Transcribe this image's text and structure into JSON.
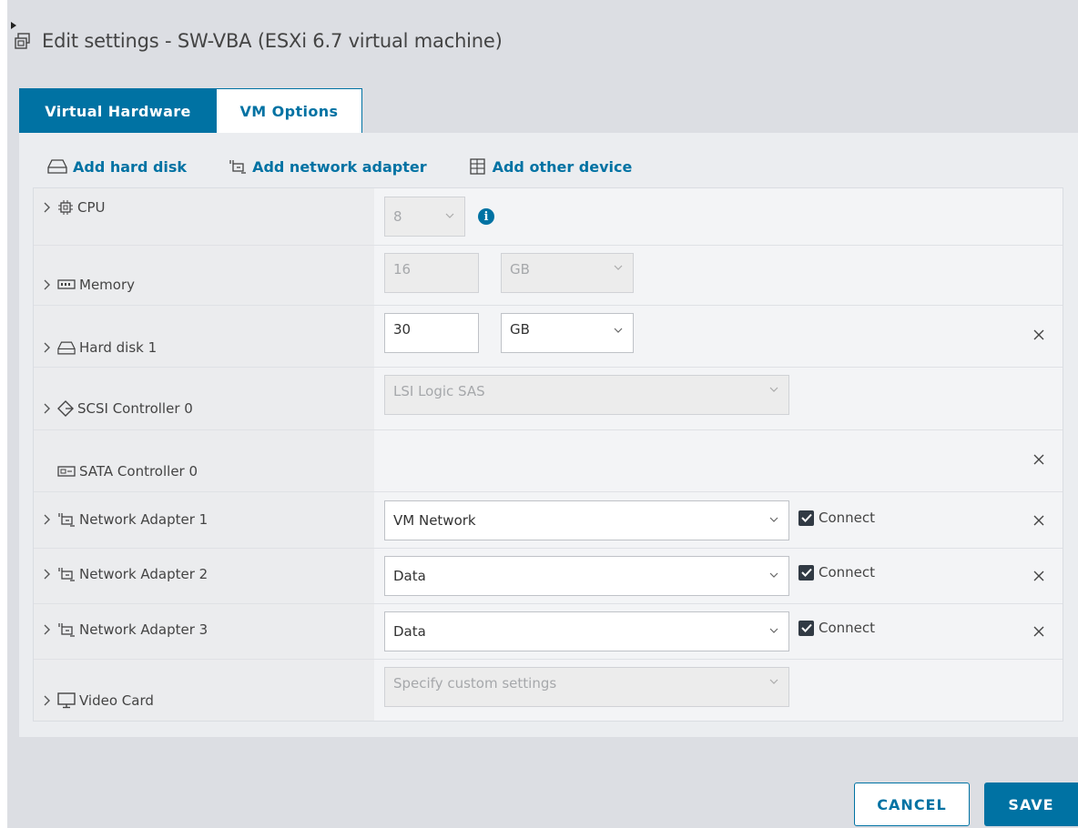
{
  "dialog": {
    "title": "Edit settings - SW-VBA (ESXi 6.7 virtual machine)"
  },
  "tabs": [
    {
      "label": "Virtual Hardware",
      "active": true
    },
    {
      "label": "VM Options",
      "active": false
    }
  ],
  "actions": {
    "add_hard_disk": "Add hard disk",
    "add_network_adapter": "Add network adapter",
    "add_other_device": "Add other device"
  },
  "rows": {
    "cpu": {
      "label": "CPU",
      "value": "8"
    },
    "memory": {
      "label": "Memory",
      "value": "16",
      "unit": "GB"
    },
    "hard_disk_1": {
      "label": "Hard disk 1",
      "value": "30",
      "unit": "GB"
    },
    "scsi_controller_0": {
      "label": "SCSI Controller 0",
      "value": "LSI Logic SAS"
    },
    "sata_controller_0": {
      "label": "SATA Controller 0"
    },
    "network_adapter_1": {
      "label": "Network Adapter 1",
      "network": "VM Network",
      "connect_label": "Connect",
      "connected": true
    },
    "network_adapter_2": {
      "label": "Network Adapter 2",
      "network": "Data",
      "connect_label": "Connect",
      "connected": true
    },
    "network_adapter_3": {
      "label": "Network Adapter 3",
      "network": "Data",
      "connect_label": "Connect",
      "connected": true
    },
    "video_card": {
      "label": "Video Card",
      "value": "Specify custom settings"
    }
  },
  "footer": {
    "cancel_label": "CANCEL",
    "save_label": "SAVE"
  },
  "colors": {
    "accent": "#0072a3",
    "background": "#dcdee3",
    "panel": "#ebedf0"
  }
}
